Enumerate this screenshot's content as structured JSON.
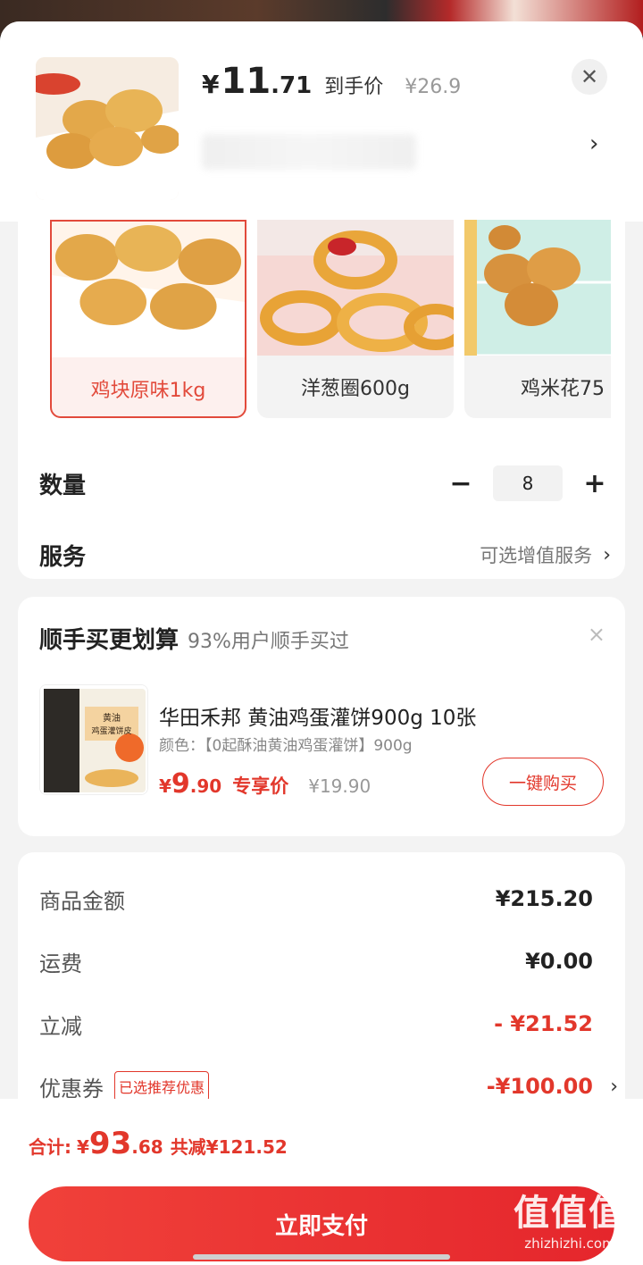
{
  "header": {
    "price_symbol": "¥",
    "price_int": "11",
    "price_dec": ".71",
    "price_tag": "到手价",
    "orig_price": "¥26.9",
    "close_icon": "close-icon",
    "spec_chevron": "›"
  },
  "variants": [
    {
      "label": "鸡块原味1kg",
      "selected": true
    },
    {
      "label": "洋葱圈600g",
      "selected": false
    },
    {
      "label": "鸡米花75",
      "selected": false
    }
  ],
  "quantity": {
    "label": "数量",
    "minus": "−",
    "value": "8",
    "plus": "+"
  },
  "service": {
    "label": "服务",
    "value": "可选增值服务",
    "chevron": "›"
  },
  "upsell": {
    "title": "顺手买更划算",
    "subtitle": "93%用户顺手买过",
    "close": "×",
    "name": "华田禾邦 黄油鸡蛋灌饼900g 10张",
    "spec": "颜色：【0起酥油黄油鸡蛋灌饼】900g",
    "price_symbol": "¥",
    "price_int": "9",
    "price_dec": ".90",
    "price_tag": "专享价",
    "orig_price": "¥19.90",
    "buy_button": "一键购买",
    "thumb_text_1": "黄油",
    "thumb_text_2": "鸡蛋灌饼皮"
  },
  "summary": {
    "rows": [
      {
        "label": "商品金额",
        "value": "¥215.20"
      },
      {
        "label": "运费",
        "value": "¥0.00"
      },
      {
        "label": "立减",
        "value": "- ¥21.52"
      },
      {
        "label": "优惠券",
        "value": "-¥100.00",
        "badge": "已选推荐优惠"
      }
    ]
  },
  "bottom": {
    "total_label": "合计:",
    "total_symbol": "¥",
    "total_int": "93",
    "total_dec": ".68",
    "saving": "共减¥121.52",
    "pay_button": "立即支付"
  },
  "watermark": {
    "big": "值值值",
    "small": "zhizhizhi.com"
  },
  "colors": {
    "accent": "#e2372b",
    "background": "#f3f3f3",
    "card": "#ffffff"
  }
}
